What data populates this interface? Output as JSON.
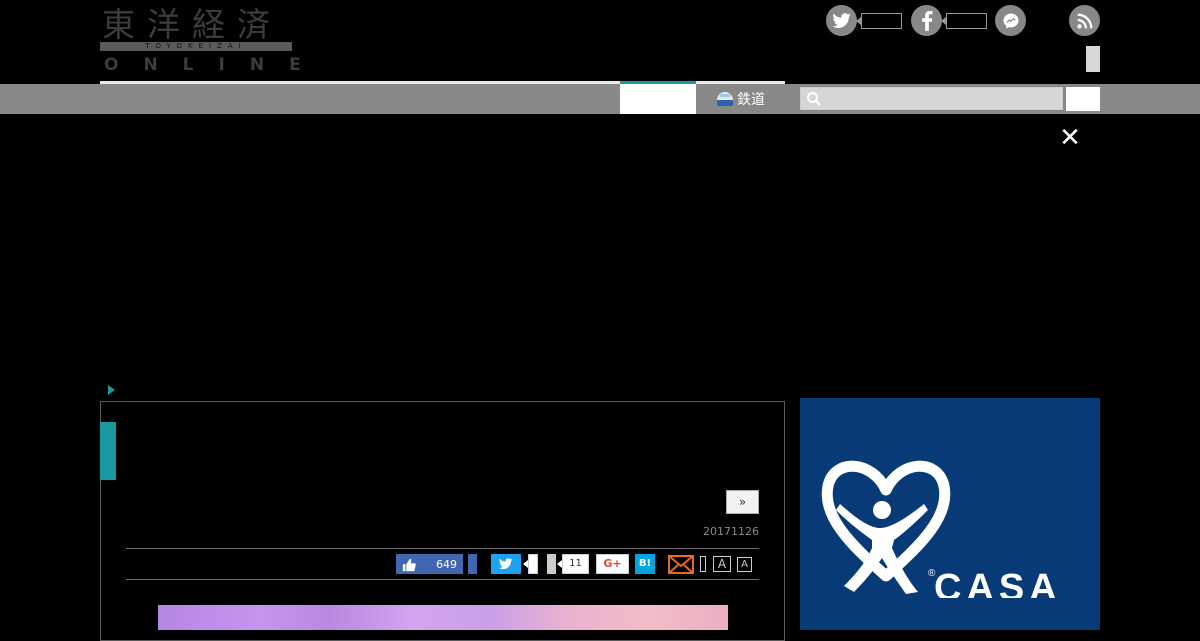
{
  "header": {
    "logo": {
      "kanji": "東洋経済",
      "romaji": "TOYOKEIZAI",
      "online": "ONLINE"
    },
    "social_icons": [
      "twitter-icon",
      "facebook-icon",
      "messenger-icon",
      "rss-icon"
    ]
  },
  "nav": {
    "rail_tab_label": "鉄道",
    "search": {
      "placeholder": "",
      "value": ""
    }
  },
  "article": {
    "next_label": "»",
    "date": "20171126",
    "share": {
      "like_count": "649",
      "share_count": "11",
      "gplus_label": "G+",
      "hatena_label": "B!",
      "font_large_label": "A",
      "font_small_label": "A"
    }
  },
  "ad": {
    "brand": "CASA",
    "registered_mark": "®",
    "background_color": "#073a77"
  },
  "colors": {
    "accent": "#1a9aa0",
    "facebook": "#4267b2",
    "twitter": "#1da1f2",
    "hatena": "#00a4de"
  }
}
